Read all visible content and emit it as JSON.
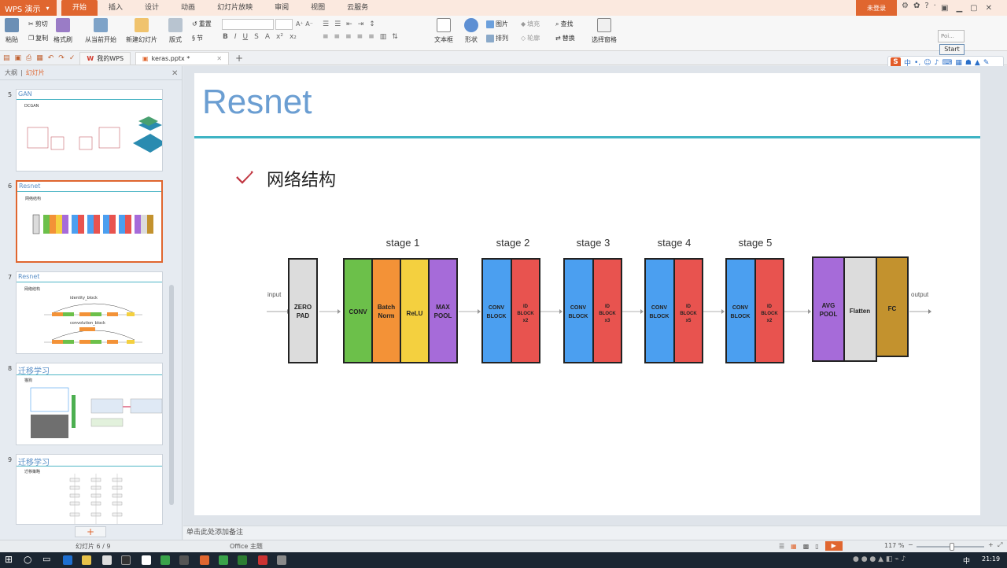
{
  "app": {
    "name": "WPS 演示",
    "menu_tabs": [
      "开始",
      "插入",
      "设计",
      "动画",
      "幻灯片放映",
      "审阅",
      "视图",
      "云服务"
    ],
    "login_label": "未登录"
  },
  "ribbon": {
    "paste": "粘贴",
    "cut": "剪切",
    "copy": "复制",
    "format_painter": "格式刷",
    "from_current": "从当前开始",
    "new_slide": "新建幻灯片",
    "layout": "版式",
    "reset": "重置",
    "section": "节",
    "textbox": "文本框",
    "shape": "形状",
    "picture": "图片",
    "fill": "填充",
    "arrange": "排列",
    "outline": "轮廓",
    "find": "查找",
    "replace": "替换",
    "select_pane": "选择窗格"
  },
  "tabs_bar": {
    "my_wps": "我的WPS",
    "doc_name": "keras.pptx *"
  },
  "start_popup": {
    "top_text": "Poi...",
    "button": "Start"
  },
  "ime": {
    "logo": "S",
    "mode": "中"
  },
  "left_panel": {
    "tab_outline": "大纲",
    "tab_slides": "幻灯片",
    "slides": [
      {
        "num": "5",
        "title": "GAN",
        "sub": "DCGAN"
      },
      {
        "num": "6",
        "title": "Resnet",
        "sub": "网络结构"
      },
      {
        "num": "7",
        "title": "Resnet",
        "sub": "网络结构"
      },
      {
        "num": "8",
        "title": "迁移学习",
        "sub": "猫狗"
      },
      {
        "num": "9",
        "title": "迁移学习",
        "sub": "迁移策略"
      }
    ],
    "thumb7_labels": [
      "identity_block",
      "convolution_block"
    ]
  },
  "slide": {
    "title": "Resnet",
    "bullet": "网络结构",
    "diagram": {
      "input_label": "input",
      "output_label": "output",
      "stage_labels": [
        "stage 1",
        "stage 2",
        "stage 3",
        "stage 4",
        "stage 5"
      ],
      "blocks": {
        "zero_pad": "ZERO PAD",
        "conv": "CONV",
        "batch_norm": "Batch Norm",
        "relu": "ReLU",
        "max_pool": "MAX POOL",
        "conv_block": "CONV BLOCK",
        "id_block_x2": "ID BLOCK x2",
        "id_block_x3": "ID BLOCK x3",
        "id_block_x5": "ID BLOCK x5",
        "avg_pool": "AVG POOL",
        "flatten": "Flatten",
        "fc": "FC"
      },
      "colors": {
        "gray": "#dcdcdc",
        "green": "#6cc04a",
        "orange": "#f39237",
        "yellow": "#f4d03f",
        "purple": "#a66bd9",
        "blue": "#4b9ff0",
        "red": "#e8534f",
        "gold": "#c3922e"
      }
    }
  },
  "notes_placeholder": "单击此处添加备注",
  "status": {
    "slide_pos": "幻灯片 6 / 9",
    "theme": "Office 主题",
    "zoom": "117 %"
  },
  "taskbar": {
    "ime": "中",
    "time": "21:19"
  }
}
